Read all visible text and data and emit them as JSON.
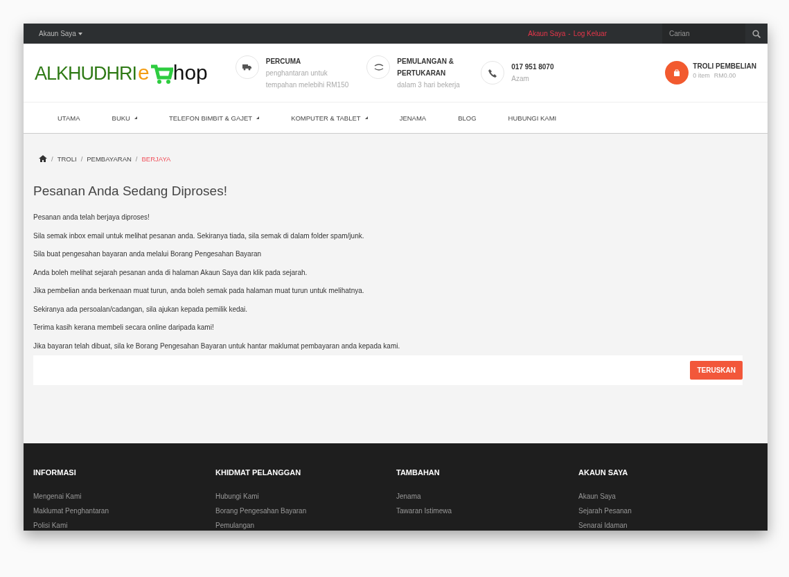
{
  "top_bar": {
    "account_menu": "Akaun Saya",
    "links": [
      "Akaun Saya",
      "Log Keluar"
    ],
    "separator": "-",
    "search": {
      "placeholder": "Carian"
    }
  },
  "header": {
    "logo": {
      "brand": "ALKHUDHRI",
      "e": "e",
      "rest": "hop"
    },
    "features": [
      {
        "kind": "truck",
        "title": "PERCUMA",
        "lines": [
          "penghantaran untuk",
          "tempahan melebihi RM150"
        ]
      },
      {
        "kind": "exchange",
        "title": "PEMULANGAN & PERTUKARAN",
        "lines": [
          "dalam 3 hari bekerja"
        ]
      },
      {
        "kind": "phone",
        "title": "017 951 8070",
        "lines": [
          "Azam"
        ]
      }
    ],
    "cart": {
      "title": "TROLI PEMBELIAN",
      "items": "0 item",
      "total": "RM0.00"
    }
  },
  "nav": [
    {
      "label": "UTAMA",
      "dropdown": false
    },
    {
      "label": "BUKU",
      "dropdown": true
    },
    {
      "label": "TELEFON BIMBIT & GAJET",
      "dropdown": true
    },
    {
      "label": "KOMPUTER & TABLET",
      "dropdown": true
    },
    {
      "label": "JENAMA",
      "dropdown": false
    },
    {
      "label": "BLOG",
      "dropdown": false
    },
    {
      "label": "HUBUNGI KAMI",
      "dropdown": false
    }
  ],
  "breadcrumb_separator": "/",
  "breadcrumbs": [
    {
      "label": "TROLI",
      "selected": false
    },
    {
      "label": "PEMBAYARAN",
      "selected": false
    },
    {
      "label": "BERJAYA",
      "selected": true
    }
  ],
  "title": "Pesanan Anda Sedang Diproses!",
  "paragraphs": [
    "Pesanan anda telah berjaya diproses!",
    "Sila semak inbox email untuk melihat pesanan anda. Sekiranya tiada, sila semak di dalam folder spam/junk.",
    "Sila buat pengesahan bayaran anda melalui Borang Pengesahan Bayaran",
    "Anda boleh melihat sejarah pesanan anda di halaman Akaun Saya dan klik pada sejarah.",
    "Jika pembelian anda berkenaan muat turun, anda boleh semak pada halaman muat turun untuk melihatnya.",
    "Sekiranya ada persoalan/cadangan, sila ajukan kepada pemilik kedai.",
    "Terima kasih kerana membeli secara online daripada kami!",
    "Jika bayaran telah dibuat, sila ke Borang Pengesahan Bayaran untuk hantar maklumat pembayaran anda kepada kami."
  ],
  "continue_button": "TERUSKAN",
  "footer": [
    {
      "heading": "INFORMASI",
      "links": [
        "Mengenai Kami",
        "Maklumat Penghantaran",
        "Polisi Kami"
      ]
    },
    {
      "heading": "KHIDMAT PELANGGAN",
      "links": [
        "Hubungi Kami",
        "Borang Pengesahan Bayaran",
        "Pemulangan"
      ]
    },
    {
      "heading": "TAMBAHAN",
      "links": [
        "Jenama",
        "Tawaran Istimewa"
      ]
    },
    {
      "heading": "AKAUN SAYA",
      "links": [
        "Akaun Saya",
        "Sejarah Pesanan",
        "Senarai Idaman"
      ]
    }
  ]
}
